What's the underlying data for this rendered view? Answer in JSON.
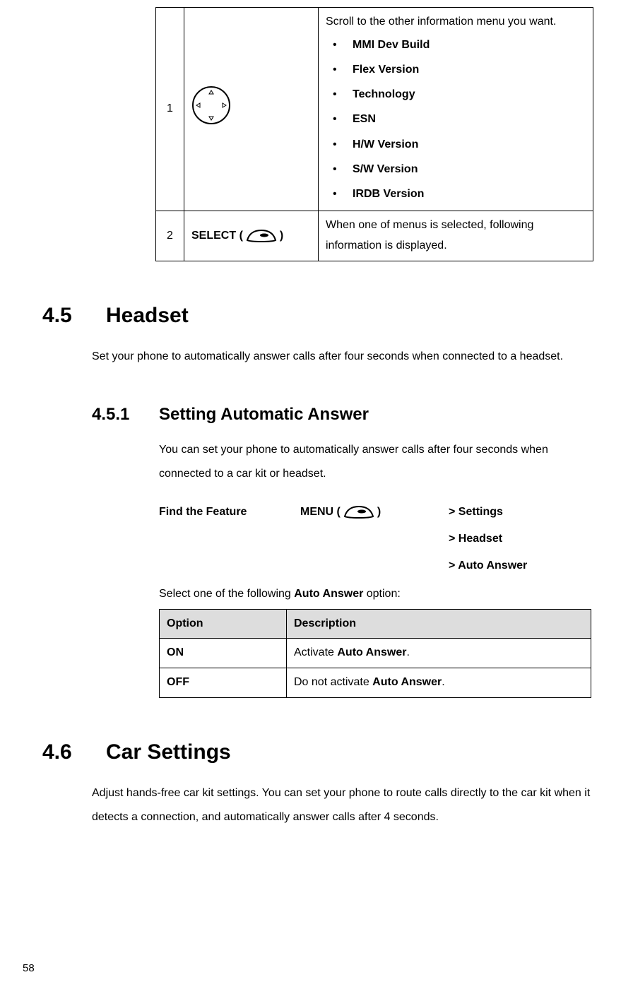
{
  "table1": {
    "row1": {
      "num": "1",
      "intro": "Scroll to the other information menu you want.",
      "items": [
        "MMI Dev Build",
        "Flex Version",
        "Technology",
        "ESN",
        "H/W Version",
        "S/W Version",
        "IRDB Version"
      ]
    },
    "row2": {
      "num": "2",
      "button_label": "SELECT (",
      "button_close": ")",
      "desc": "When one of menus is selected, following information is displayed."
    }
  },
  "section45": {
    "num": "4.5",
    "title": "Headset",
    "body": "Set your phone to automatically answer calls after four seconds when connected to a headset."
  },
  "section451": {
    "num": "4.5.1",
    "title": "Setting Automatic Answer",
    "body": "You can set your phone to automatically answer calls after four seconds when connected to a car kit or headset.",
    "find_feature": "Find the Feature",
    "menu_label": "MENU (",
    "menu_close": ")",
    "path1": "> Settings",
    "path2": "> Headset",
    "path3": "> Auto Answer",
    "select_text_a": "Select one of the following ",
    "select_text_b": "Auto Answer",
    "select_text_c": " option:",
    "header_option": "Option",
    "header_desc": "Description",
    "row_on_opt": "ON",
    "row_on_desc_a": "Activate ",
    "row_on_desc_b": "Auto Answer",
    "row_on_desc_c": ".",
    "row_off_opt": "OFF",
    "row_off_desc_a": "Do not activate ",
    "row_off_desc_b": "Auto Answer",
    "row_off_desc_c": "."
  },
  "section46": {
    "num": "4.6",
    "title": "Car Settings",
    "body": "Adjust hands-free car kit settings. You can set your phone to route calls directly to the car kit when it detects a connection, and automatically answer calls after 4 seconds."
  },
  "page_number": "58"
}
